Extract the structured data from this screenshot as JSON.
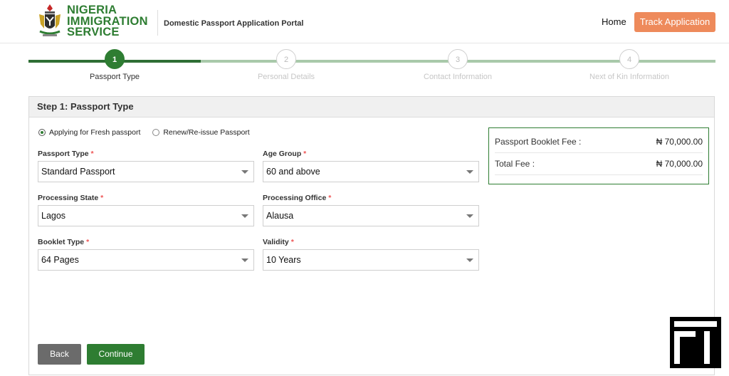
{
  "header": {
    "brand_line1": "NIGERIA",
    "brand_line2": "IMMIGRATION",
    "brand_line3": "SERVICE",
    "portal_title": "Domestic Passport Application Portal",
    "nav_home": "Home",
    "track_button": "Track Application",
    "accent_color": "#ee8a5b",
    "brand_color": "#2e7d32"
  },
  "stepper": {
    "steps": [
      {
        "number": "1",
        "label": "Passport Type",
        "active": true
      },
      {
        "number": "2",
        "label": "Personal Details",
        "active": false
      },
      {
        "number": "3",
        "label": "Contact Information",
        "active": false
      },
      {
        "number": "4",
        "label": "Next of Kin Information",
        "active": false
      }
    ]
  },
  "form": {
    "title": "Step 1: Passport Type",
    "radio_fresh": "Applying for Fresh passport",
    "radio_renew": "Renew/Re-issue Passport",
    "selected_radio": "fresh",
    "required_mark": "*",
    "fields": {
      "passport_type": {
        "label": "Passport Type",
        "value": "Standard Passport"
      },
      "age_group": {
        "label": "Age Group",
        "value": "60 and above"
      },
      "processing_state": {
        "label": "Processing State",
        "value": "Lagos"
      },
      "processing_office": {
        "label": "Processing Office",
        "value": "Alausa"
      },
      "booklet_type": {
        "label": "Booklet Type",
        "value": "64 Pages"
      },
      "validity": {
        "label": "Validity",
        "value": "10 Years"
      }
    },
    "back_button": "Back",
    "continue_button": "Continue"
  },
  "fees": {
    "booklet_label": "Passport Booklet Fee :",
    "booklet_value": "₦ 70,000.00",
    "total_label": "Total Fee :",
    "total_value": "₦ 70,000.00"
  },
  "icons": {
    "coat_of_arms": "coat-of-arms-icon",
    "dropdown": "chevron-down-icon",
    "corner_logo": "fi-logo-icon"
  }
}
